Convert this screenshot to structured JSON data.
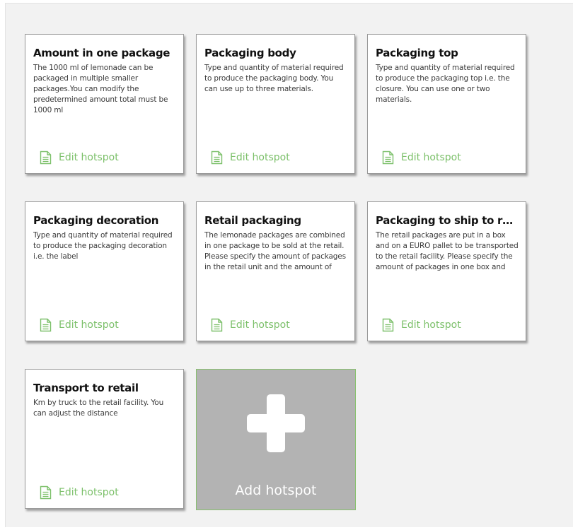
{
  "cards": [
    {
      "title": "Amount in one package",
      "description": "The 1000 ml of lemonade can be packaged in multiple smaller packages.You can modify the predetermined amount total must be 1000 ml",
      "edit_label": "Edit hotspot"
    },
    {
      "title": "Packaging body",
      "description": "Type and quantity of material required to produce the packaging body. You can use up to three materials.",
      "edit_label": "Edit hotspot"
    },
    {
      "title": "Packaging top",
      "description": "Type and quantity of material required to produce the packaging top i.e. the closure. You can use one or two materials.",
      "edit_label": "Edit hotspot"
    },
    {
      "title": "Packaging decoration",
      "description": "Type and quantity of material required to produce the packaging decoration i.e. the label",
      "edit_label": "Edit hotspot"
    },
    {
      "title": "Retail packaging",
      "description": "The lemonade packages are combined in one package to be sold at the retail. Please specify the amount of packages in the retail unit and the amount of",
      "edit_label": "Edit hotspot"
    },
    {
      "title": "Packaging to ship to re...",
      "description": "The retail packages are put in a box and on a EURO pallet to be transported to the retail facility. Please specify the amount of packages in one box and",
      "edit_label": "Edit hotspot"
    },
    {
      "title": "Transport to retail",
      "description": "Km by truck to the retail facility. You can adjust the distance",
      "edit_label": "Edit hotspot"
    }
  ],
  "add_card": {
    "label": "Add hotspot",
    "icon": "plus-icon"
  },
  "icons": {
    "edit": "document-icon"
  },
  "colors": {
    "accent_green": "#7cc06a",
    "add_card_bg": "#b3b3b3",
    "panel_bg": "#f2f2f2"
  }
}
